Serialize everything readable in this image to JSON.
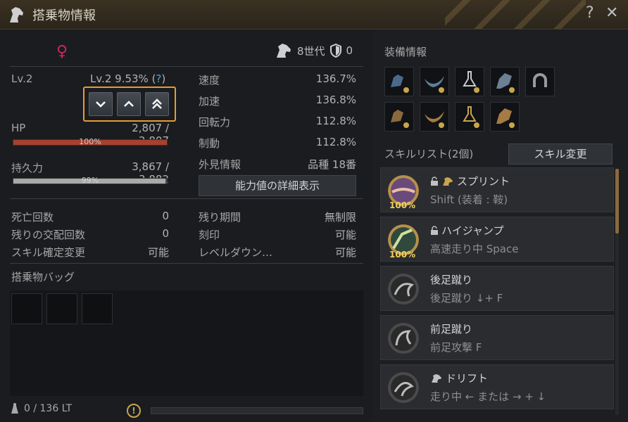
{
  "window": {
    "title": "搭乗物情報",
    "help": "?",
    "close": "✕"
  },
  "mount": {
    "generation": "8世代",
    "shield_value": "0",
    "level_label": "Lv.2",
    "level_progress": "Lv.2 9.53% (",
    "level_help": "?",
    "level_close": ")",
    "hp": {
      "label": "HP",
      "value": "2,807 / 2,807",
      "percent": "100%",
      "fraction": 1.0,
      "color": "#a8402e"
    },
    "stamina": {
      "label": "持久力",
      "value": "3,867 / 3,882",
      "percent": "99%",
      "fraction": 0.99,
      "color": "#a9a9a9"
    }
  },
  "stats": [
    {
      "label": "速度",
      "value": "136.7%"
    },
    {
      "label": "加速",
      "value": "136.8%"
    },
    {
      "label": "回転力",
      "value": "112.8%"
    },
    {
      "label": "制動",
      "value": "112.8%"
    },
    {
      "label": "外見情報",
      "value": "品種 18番"
    }
  ],
  "detail_button": "能力値の詳細表示",
  "info_left": [
    {
      "label": "死亡回数",
      "value": "0"
    },
    {
      "label": "残りの交配回数",
      "value": "0"
    },
    {
      "label": "スキル確定変更",
      "value": "可能"
    }
  ],
  "info_right": [
    {
      "label": "残り期間",
      "value": "無制限"
    },
    {
      "label": "刻印",
      "value": "可能"
    },
    {
      "label": "レベルダウン…",
      "value": "可能"
    }
  ],
  "bag": {
    "title": "搭乗物バッグ",
    "weight": "0 / 136 LT"
  },
  "equipment": {
    "title": "装備情報"
  },
  "skills": {
    "title": "スキルリスト(2個)",
    "change_button": "スキル変更",
    "items": [
      {
        "name": "スプリント",
        "command": "Shift (装着 : 鞍)",
        "percent": "100%"
      },
      {
        "name": "ハイジャンプ",
        "command": "高速走り中 Space",
        "percent": "100%"
      },
      {
        "name": "後足蹴り",
        "command": "後足蹴り ↓+ F"
      },
      {
        "name": "前足蹴り",
        "command": "前足攻撃 F"
      },
      {
        "name": "ドリフト",
        "command": "走り中 ← または → + ↓"
      }
    ]
  }
}
